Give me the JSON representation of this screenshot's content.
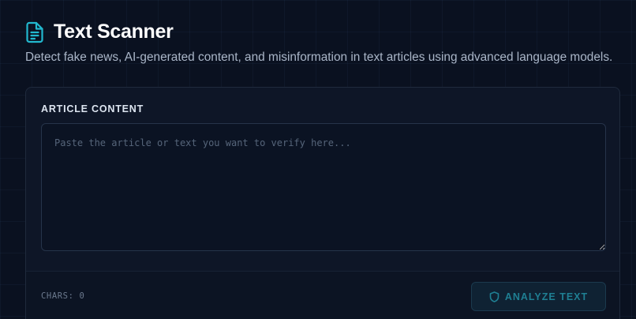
{
  "header": {
    "title": "Text Scanner",
    "subtitle": "Detect fake news, AI-generated content, and misinformation in text articles using advanced language models.",
    "icon": "document-icon"
  },
  "form": {
    "section_label": "ARTICLE CONTENT",
    "textarea_value": "",
    "textarea_placeholder": "Paste the article or text you want to verify here...",
    "char_count_text": "CHARS: 0",
    "analyze_label": "ANALYZE TEXT",
    "analyze_icon": "shield-icon"
  },
  "colors": {
    "background": "#0a1120",
    "accent": "#22b8cf",
    "button_text": "#1f7f93",
    "card": "#0e1627"
  }
}
